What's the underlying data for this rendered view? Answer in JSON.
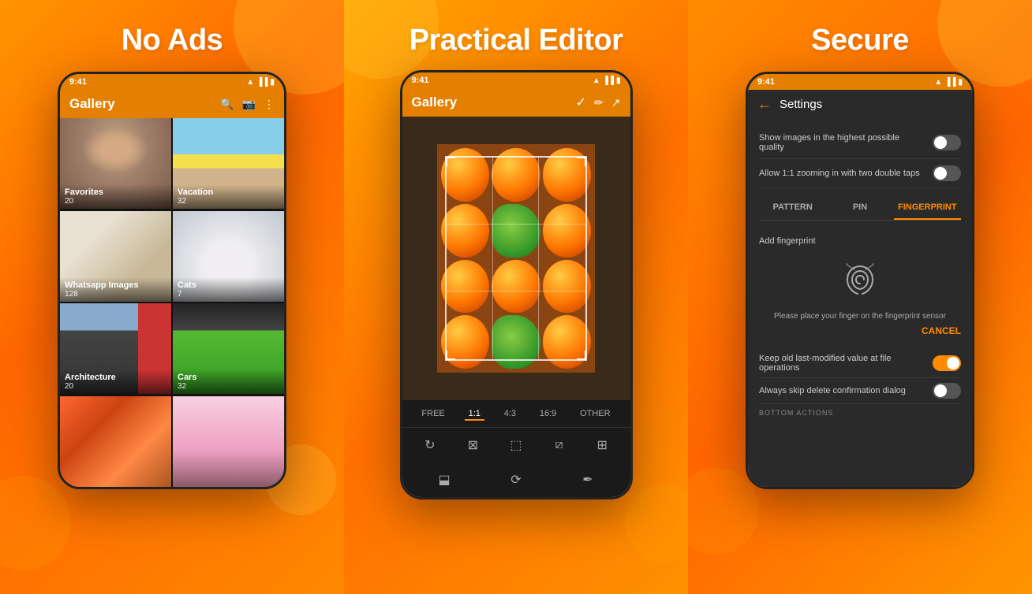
{
  "panel1": {
    "heading": "No Ads",
    "app_title": "Gallery",
    "status_time": "9:41",
    "gallery_items": [
      {
        "label": "Favorites",
        "count": "20",
        "bg": "face"
      },
      {
        "label": "Vacation",
        "count": "32",
        "bg": "beach"
      },
      {
        "label": "Whatsapp Images",
        "count": "128",
        "bg": "kitchen"
      },
      {
        "label": "Cats",
        "count": "7",
        "bg": "cat"
      },
      {
        "label": "Architecture",
        "count": "20",
        "bg": "arch"
      },
      {
        "label": "Cars",
        "count": "32",
        "bg": "car"
      },
      {
        "label": "",
        "count": "",
        "bg": "art"
      },
      {
        "label": "",
        "count": "",
        "bg": "cherry"
      }
    ]
  },
  "panel2": {
    "heading": "Practical Editor",
    "app_title": "Gallery",
    "status_time": "9:41",
    "ratio_options": [
      "FREE",
      "1:1",
      "4:3",
      "16:9",
      "OTHER"
    ],
    "active_ratio": "1:1",
    "tools": [
      "rotate",
      "crop-x",
      "crop",
      "split-v",
      "grid"
    ]
  },
  "panel3": {
    "heading": "Secure",
    "app_title": "Settings",
    "status_time": "9:41",
    "back_label": "←",
    "settings": [
      {
        "text": "Show images in the highest possible quality",
        "toggle": "off"
      },
      {
        "text": "Allow 1:1 zooming in with two double taps",
        "toggle": "off"
      }
    ],
    "security_tabs": [
      "PATTERN",
      "PIN",
      "FINGERPRINT"
    ],
    "active_tab": "FINGERPRINT",
    "add_fingerprint_label": "Add fingerprint",
    "fingerprint_instruction": "Please place your finger on the fingerprint sensor",
    "cancel_label": "CANCEL",
    "bottom_settings": [
      {
        "text": "Keep old last-modified value at file operations",
        "toggle": "on"
      },
      {
        "text": "Always skip delete confirmation dialog",
        "toggle": "off"
      }
    ],
    "bottom_actions_label": "BOTTOM ACTIONS"
  }
}
